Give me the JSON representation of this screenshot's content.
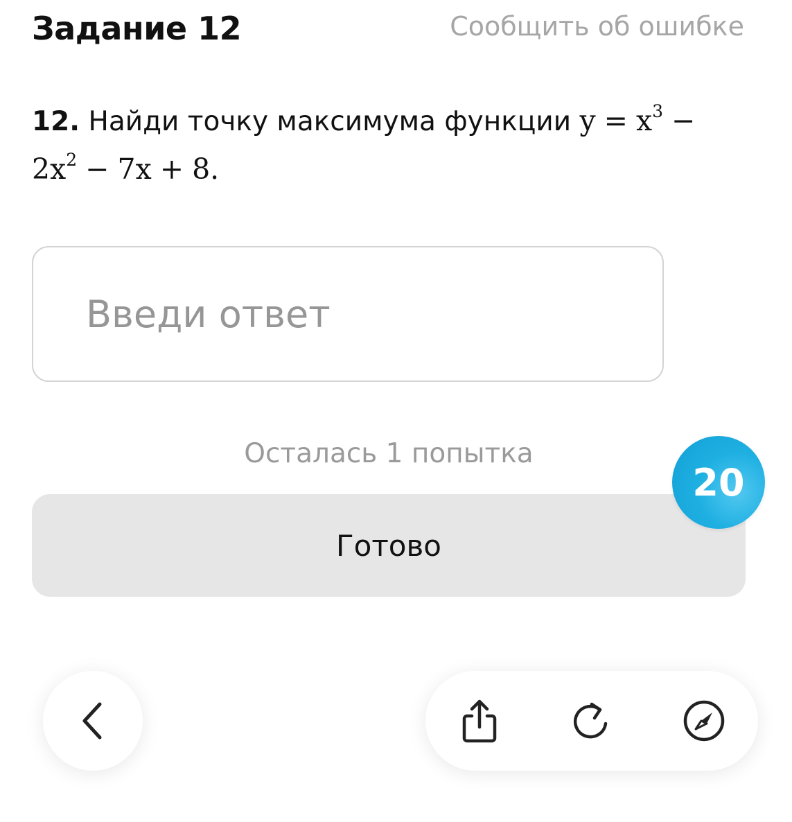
{
  "header": {
    "title": "Задание 12",
    "report_link": "Сообщить об ошибке"
  },
  "problem": {
    "number": "12.",
    "text": "Найди точку максимума функции",
    "formula": {
      "y": "y",
      "eq": "=",
      "x": "x",
      "exp3": "3",
      "minus1": "−",
      "coef2": "2",
      "exp2": "2",
      "minus2": "−",
      "term3": "7x",
      "plus": "+",
      "const": "8",
      "end": "."
    }
  },
  "answer": {
    "placeholder": "Введи ответ",
    "value": ""
  },
  "attempts": "Осталась 1 попытка",
  "done_button": "Готово",
  "badge": "20",
  "colors": {
    "badge": "#1fb0e2",
    "button_bg": "#e6e6e6",
    "muted_text": "#9a9a9a"
  },
  "icons": {
    "back": "chevron-left-icon",
    "share": "share-icon",
    "reload": "reload-icon",
    "compass": "compass-icon"
  }
}
